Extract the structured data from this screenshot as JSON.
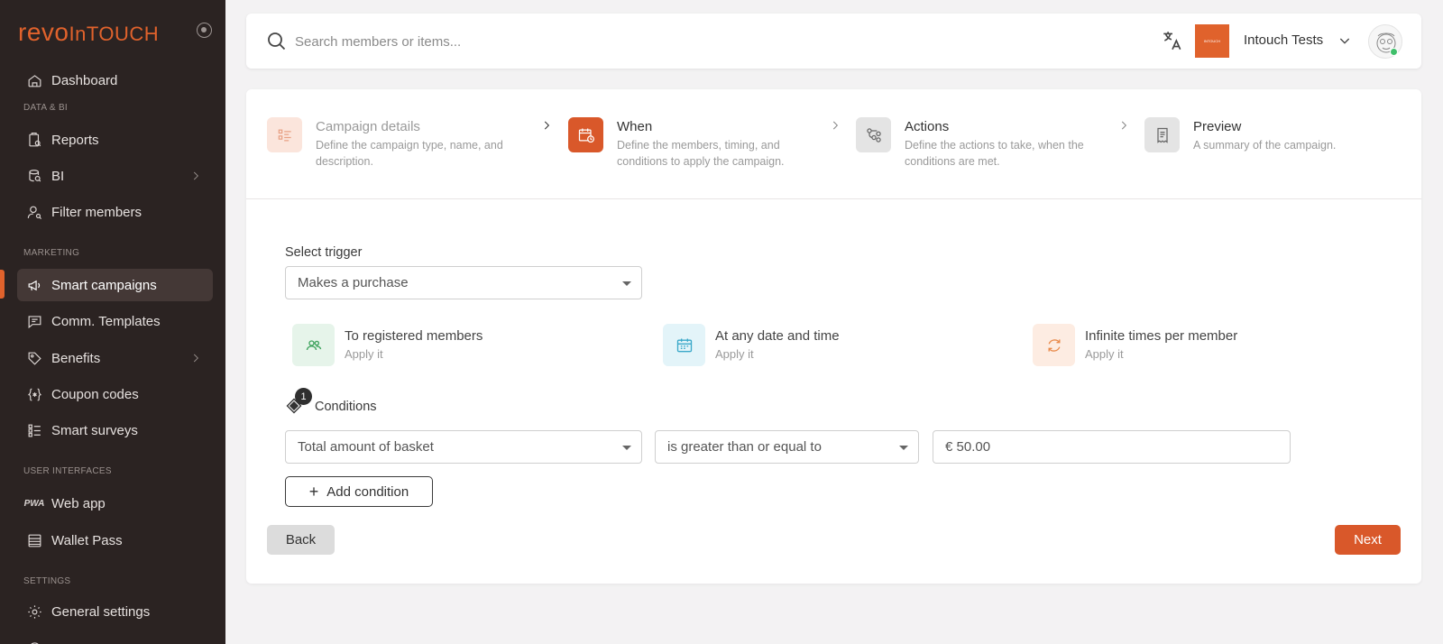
{
  "sidebar": {
    "logo_revo": "revo",
    "logo_intouch": "InTOUCH",
    "sections": {
      "data_bi": "DATA & BI",
      "marketing": "MARKETING",
      "user_interfaces": "USER INTERFACES",
      "settings": "SETTINGS"
    },
    "items": {
      "dashboard": "Dashboard",
      "reports": "Reports",
      "bi": "BI",
      "filter_members": "Filter members",
      "smart_campaigns": "Smart campaigns",
      "comm_templates": "Comm. Templates",
      "benefits": "Benefits",
      "coupon_codes": "Coupon codes",
      "smart_surveys": "Smart surveys",
      "web_app": "Web app",
      "wallet_pass": "Wallet Pass",
      "general_settings": "General settings"
    },
    "active_item": "smart_campaigns"
  },
  "topbar": {
    "search_placeholder": "Search members or items...",
    "brand_tile_text": "INTOUCH",
    "account_name": "Intouch Tests"
  },
  "steps": [
    {
      "title": "Campaign details",
      "description": "Define the campaign type, name, and description.",
      "state": "completed"
    },
    {
      "title": "When",
      "description": "Define the members, timing, and conditions to apply the campaign.",
      "state": "active"
    },
    {
      "title": "Actions",
      "description": "Define the actions to take, when the conditions are met.",
      "state": "upcoming"
    },
    {
      "title": "Preview",
      "description": "A summary of the campaign.",
      "state": "upcoming"
    }
  ],
  "trigger": {
    "label": "Select trigger",
    "value": "Makes a purchase"
  },
  "summary": [
    {
      "title": "To registered members",
      "subtitle": "Apply it",
      "icon": "members-icon",
      "color": "#e9f5ec"
    },
    {
      "title": "At any date and time",
      "subtitle": "Apply it",
      "icon": "calendar-icon",
      "color": "#e6f5f9"
    },
    {
      "title": "Infinite times per member",
      "subtitle": "Apply it",
      "icon": "repeat-icon",
      "color": "#fdeee4"
    }
  ],
  "conditions": {
    "label": "Conditions",
    "count": "1",
    "field": "Total amount of basket",
    "operator": "is greater than or equal to",
    "value": "€ 50.00"
  },
  "buttons": {
    "add_condition": "Add condition",
    "back": "Back",
    "next": "Next"
  },
  "colors": {
    "accent": "#d9582a",
    "sidebar_bg": "#2b2322"
  }
}
